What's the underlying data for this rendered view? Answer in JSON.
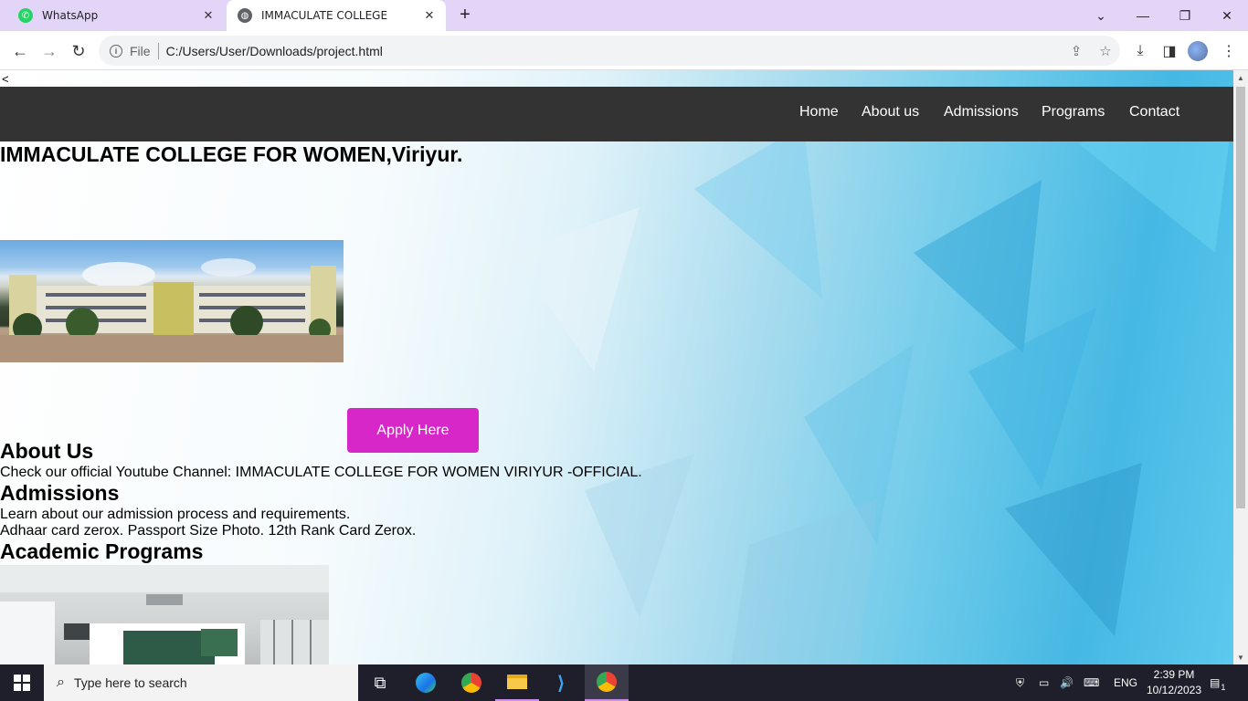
{
  "browser": {
    "tabs": [
      {
        "title": "WhatsApp",
        "icon": "whatsapp-icon",
        "color": "#25d366"
      },
      {
        "title": "IMMACULATE COLLEGE",
        "icon": "globe-icon",
        "color": "#5f6368"
      }
    ],
    "omnibox": {
      "scheme_label": "File",
      "url": "C:/Users/User/Downloads/project.html"
    }
  },
  "page": {
    "back_marker": "<",
    "nav": [
      "Home",
      "About us",
      "Admissions",
      "Programs",
      "Contact"
    ],
    "title": "IMMACULATE COLLEGE FOR WOMEN,Viriyur.",
    "apply_button": "Apply Here",
    "apply_color": "#d827c9",
    "about": {
      "heading": "About Us",
      "text": "Check our official Youtube Channel: IMMACULATE COLLEGE FOR WOMEN VIRIYUR -OFFICIAL."
    },
    "admissions": {
      "heading": "Admissions",
      "line1": "Learn about our admission process and requirements.",
      "line2": "Adhaar card zerox. Passport Size Photo. 12th Rank Card Zerox."
    },
    "programs": {
      "heading": "Academic Programs"
    }
  },
  "taskbar": {
    "search_placeholder": "Type here to search",
    "language": "ENG",
    "time": "2:39 PM",
    "date": "10/12/2023",
    "notification_count": "1"
  }
}
